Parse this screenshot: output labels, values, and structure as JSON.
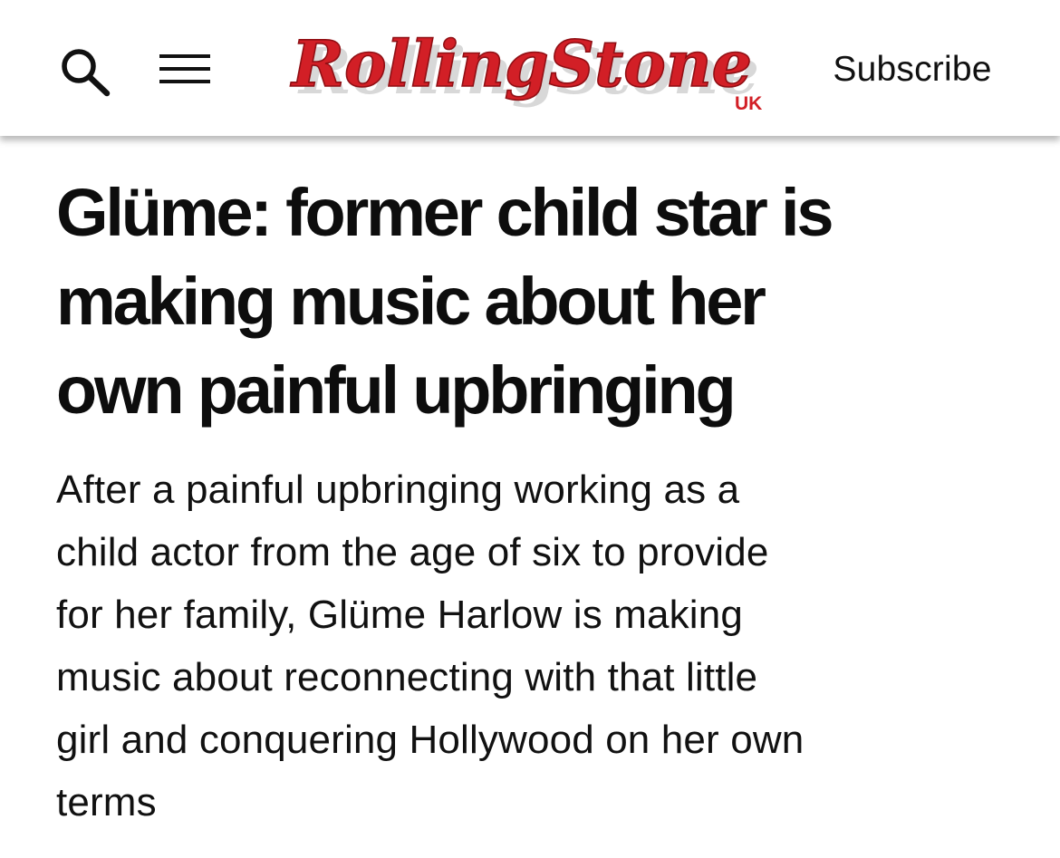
{
  "header": {
    "search_icon": "search-icon",
    "menu_icon": "hamburger-menu-icon",
    "logo": {
      "wordmark": "RollingStone",
      "edition": "UK",
      "colors": {
        "fill": "#d21f26",
        "outline": "#8f0f14",
        "shadow": "#d9d9d9"
      }
    },
    "subscribe_label": "Subscribe"
  },
  "article": {
    "headline": "Glüme: former child star is\nmaking music about her\nown painful upbringing",
    "dek": "After a painful upbringing working as a\nchild actor from the age of six to provide\nfor her family, Glüme Harlow is making\nmusic about reconnecting with that little\ngirl and conquering Hollywood on her own\nterms"
  }
}
